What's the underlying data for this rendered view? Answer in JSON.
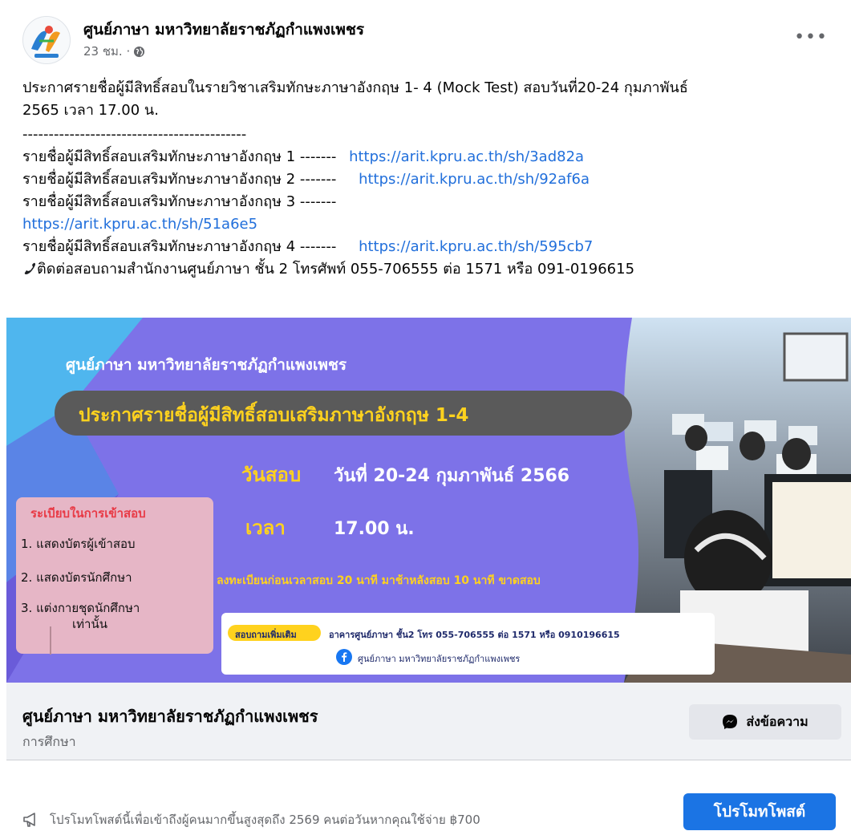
{
  "post": {
    "page_name": "ศูนย์ภาษา มหาวิทยาลัยราชภัฏกำแพงเพชร",
    "time": "23 ชม. · ",
    "more_label": "•••",
    "body": {
      "line1": "ประกาศรายชื่อผู้มีสิทธิ์สอบในรายวิชาเสริมทักษะภาษาอังกฤษ 1- 4 (Mock Test) สอบวันที่20-24 กุมภาพันธ์",
      "line2": "2565 เวลา 17.00 น.",
      "separator": "-------------------------------------------",
      "items": [
        {
          "label": "รายชื่อผู้มีสิทธิ์สอบเสริมทักษะภาษาอังกฤษ 1 -------",
          "link": "https://arit.kpru.ac.th/sh/3ad82a"
        },
        {
          "label": "รายชื่อผู้มีสิทธิ์สอบเสริมทักษะภาษาอังกฤษ 2 -------",
          "link": "https://arit.kpru.ac.th/sh/92af6a"
        },
        {
          "label": "รายชื่อผู้มีสิทธิ์สอบเสริมทักษะภาษาอังกฤษ 3 -------",
          "link": "https://arit.kpru.ac.th/sh/51a6e5"
        },
        {
          "label": "รายชื่อผู้มีสิทธิ์สอบเสริมทักษะภาษาอังกฤษ 4 -------",
          "link": "https://arit.kpru.ac.th/sh/595cb7"
        }
      ],
      "contact": "ติดต่อสอบถามสำนักงานศูนย์ภาษา ชั้น 2 โทรศัพท์ 055-706555 ต่อ 1571  หรือ 091-0196615"
    }
  },
  "banner": {
    "org": "ศูนย์ภาษา มหาวิทยาลัยราชภัฏกำแพงเพชร",
    "headline": "ประกาศรายชื่อผู้มีสิทธิ์สอบเสริมภาษาอังกฤษ 1-4",
    "date_label": "วันสอบ",
    "date_value": "วันที่ 20-24 กุมภาพันธ์ 2566",
    "time_label": "เวลา",
    "time_value": "17.00 น.",
    "rules_title": "ระเบียบในการเข้าสอบ",
    "rule1": "1. แสดงบัตรผู้เข้าสอบ",
    "rule2": "2. แสดงบัตรนักศึกษา",
    "rule3a": "3. แต่งกายชุดนักศึกษา",
    "rule3b": "เท่านั้น",
    "register_note": "ลงทะเบียนก่อนเวลาสอบ 20 นาที มาช้าหลังสอบ 10 นาที ขาดสอบ",
    "contact_tag": "สอบถามเพิ่มเติม",
    "contact_text": "อาคารศูนย์ภาษา ชั้น2 โทร 055-706555 ต่อ 1571  หรือ 0910196615",
    "fb_name": "ศูนย์ภาษา มหาวิทยาลัยราชภัฏกำแพงเพชร"
  },
  "card": {
    "title": "ศูนย์ภาษา มหาวิทยาลัยราชภัฏกำแพงเพชร",
    "category": "การศึกษา",
    "message_button": "ส่งข้อความ"
  },
  "promo": {
    "text": "โปรโมทโพสต์นี้เพื่อเข้าถึงผู้คนมากขึ้นสูงสุดถึง 2569 คนต่อวันหากคุณใช้จ่าย ฿700",
    "button": "โปรโมทโพสต์"
  },
  "colors": {
    "link": "#216fdb",
    "primary": "#1b74e4",
    "banner_bg": "#7d72e8",
    "accent_yellow": "#ffd21e"
  },
  "icons": [
    "globe-icon",
    "more-icon",
    "phone-icon",
    "messenger-icon",
    "megaphone-icon",
    "facebook-icon"
  ]
}
